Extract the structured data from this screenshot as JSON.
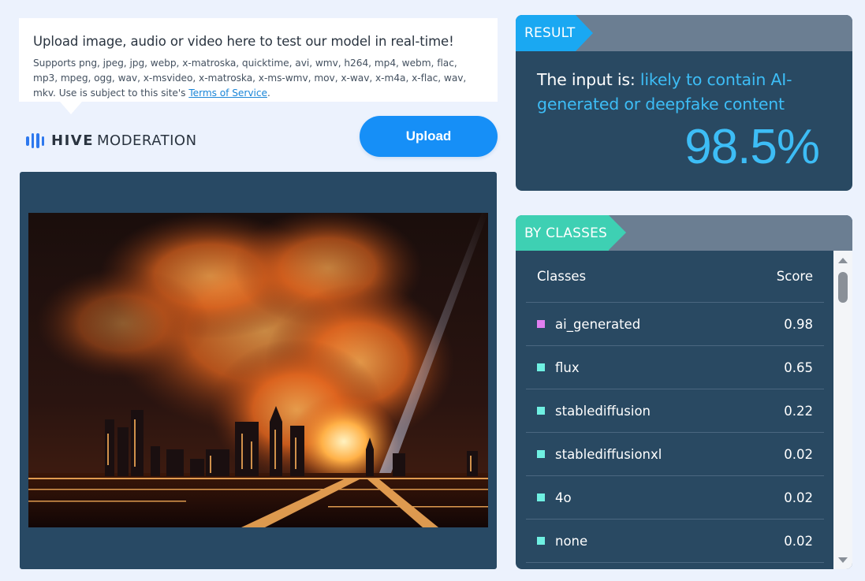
{
  "info": {
    "title": "Upload image, audio or video here to test our model in real-time!",
    "description": "Supports png, jpeg, jpg, webp, x-matroska, quicktime, avi, wmv, h264, mp4, webm, flac, mp3, mpeg, ogg, wav, x-msvideo, x-matroska, x-ms-wmv, mov, x-wav, x-m4a, x-flac, wav, mkv. Use is subject to this site's ",
    "terms_link": "Terms of Service",
    "period": "."
  },
  "logo": {
    "brand": "HIVE",
    "product": "MODERATION",
    "icon": "hive-bars-icon"
  },
  "upload_button": {
    "label": "Upload"
  },
  "result": {
    "tag": "RESULT",
    "prefix": "The input is: ",
    "verdict": "likely to contain AI-generated or deepfake content",
    "percentage": "98.5%"
  },
  "classes": {
    "tag": "BY CLASSES",
    "header_class": "Classes",
    "header_score": "Score",
    "rows": [
      {
        "name": "ai_generated",
        "score": "0.98",
        "color": "#e07ff0"
      },
      {
        "name": "flux",
        "score": "0.65",
        "color": "#6ff0e2"
      },
      {
        "name": "stablediffusion",
        "score": "0.22",
        "color": "#6ff0e2"
      },
      {
        "name": "stablediffusionxl",
        "score": "0.02",
        "color": "#6ff0e2"
      },
      {
        "name": "4o",
        "score": "0.02",
        "color": "#6ff0e2"
      },
      {
        "name": "none",
        "score": "0.02",
        "color": "#6ff0e2"
      }
    ]
  },
  "colors": {
    "accent_blue": "#168ff7",
    "result_tag": "#1aa8f2",
    "classes_tag": "#3ed0b3",
    "panel": "#294962",
    "percentage": "#3dbdf6"
  }
}
